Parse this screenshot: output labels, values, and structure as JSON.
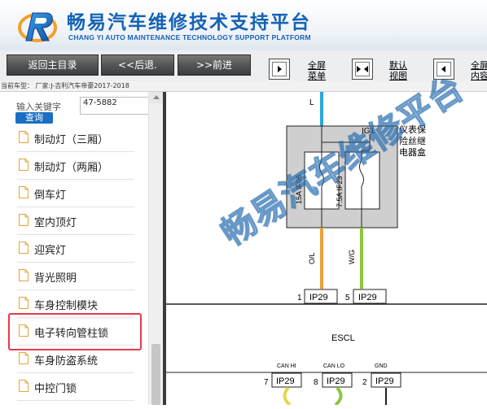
{
  "brand": {
    "title": "畅易汽车维修技术支持平台",
    "subtitle": "CHANG YI AUTO MAINTENANCE TECHNOLOGY SUPPORT PLATFORM",
    "color": "#1462b5"
  },
  "toolbar": {
    "home_label": "返回主目录",
    "back_label": "<<后退.",
    "forward_label": ">>前进",
    "fullscreen_menu_label": "全屏\n菜单",
    "default_view_label": "默认\n视图",
    "fullscreen_content_label": "全屏\n内容"
  },
  "vehicle_info": "当前车型： 厂家:J-吉利汽车帝豪2017-2018",
  "search": {
    "label": "输入关键字",
    "value": "47-5882",
    "button": "查询",
    "button_color": "#1a6fc4"
  },
  "menu": {
    "items": [
      {
        "label": "制动灯（三厢）"
      },
      {
        "label": "制动灯（两厢）"
      },
      {
        "label": "倒车灯"
      },
      {
        "label": "室内顶灯"
      },
      {
        "label": "迎宾灯"
      },
      {
        "label": "背光照明"
      },
      {
        "label": "车身控制模块"
      },
      {
        "label": "电子转向管柱锁"
      },
      {
        "label": "车身防盗系统"
      },
      {
        "label": "中控门锁"
      }
    ],
    "selected_index": 7,
    "highlight_color": "#e53b4b"
  },
  "diagram": {
    "wire_top": "L",
    "fuse_box_label": "仪表保\n险丝继\n电器盒",
    "ig_label": "IG1",
    "fuse_left": "15A IF06",
    "fuse_right": "7.5A IF23",
    "wire_left": "O/L",
    "wire_right": "W/G",
    "conn_top_1_pin": "1",
    "conn_top_1_name": "IP29",
    "conn_top_2_pin": "5",
    "conn_top_2_name": "IP29",
    "module_label": "ESCL",
    "sig_1": "CAN HI",
    "sig_2": "CAN LO",
    "sig_3": "GND",
    "conn_bot_1_pin": "7",
    "conn_bot_1_name": "IP29",
    "conn_bot_2_pin": "8",
    "conn_bot_2_name": "IP29",
    "conn_bot_3_pin": "2",
    "conn_bot_3_name": "IP29",
    "wire_colors": {
      "blue": "#2aa6e0",
      "orange": "#e8a13c",
      "green": "#8cc63f"
    }
  },
  "watermark": "畅易汽车维修平台"
}
